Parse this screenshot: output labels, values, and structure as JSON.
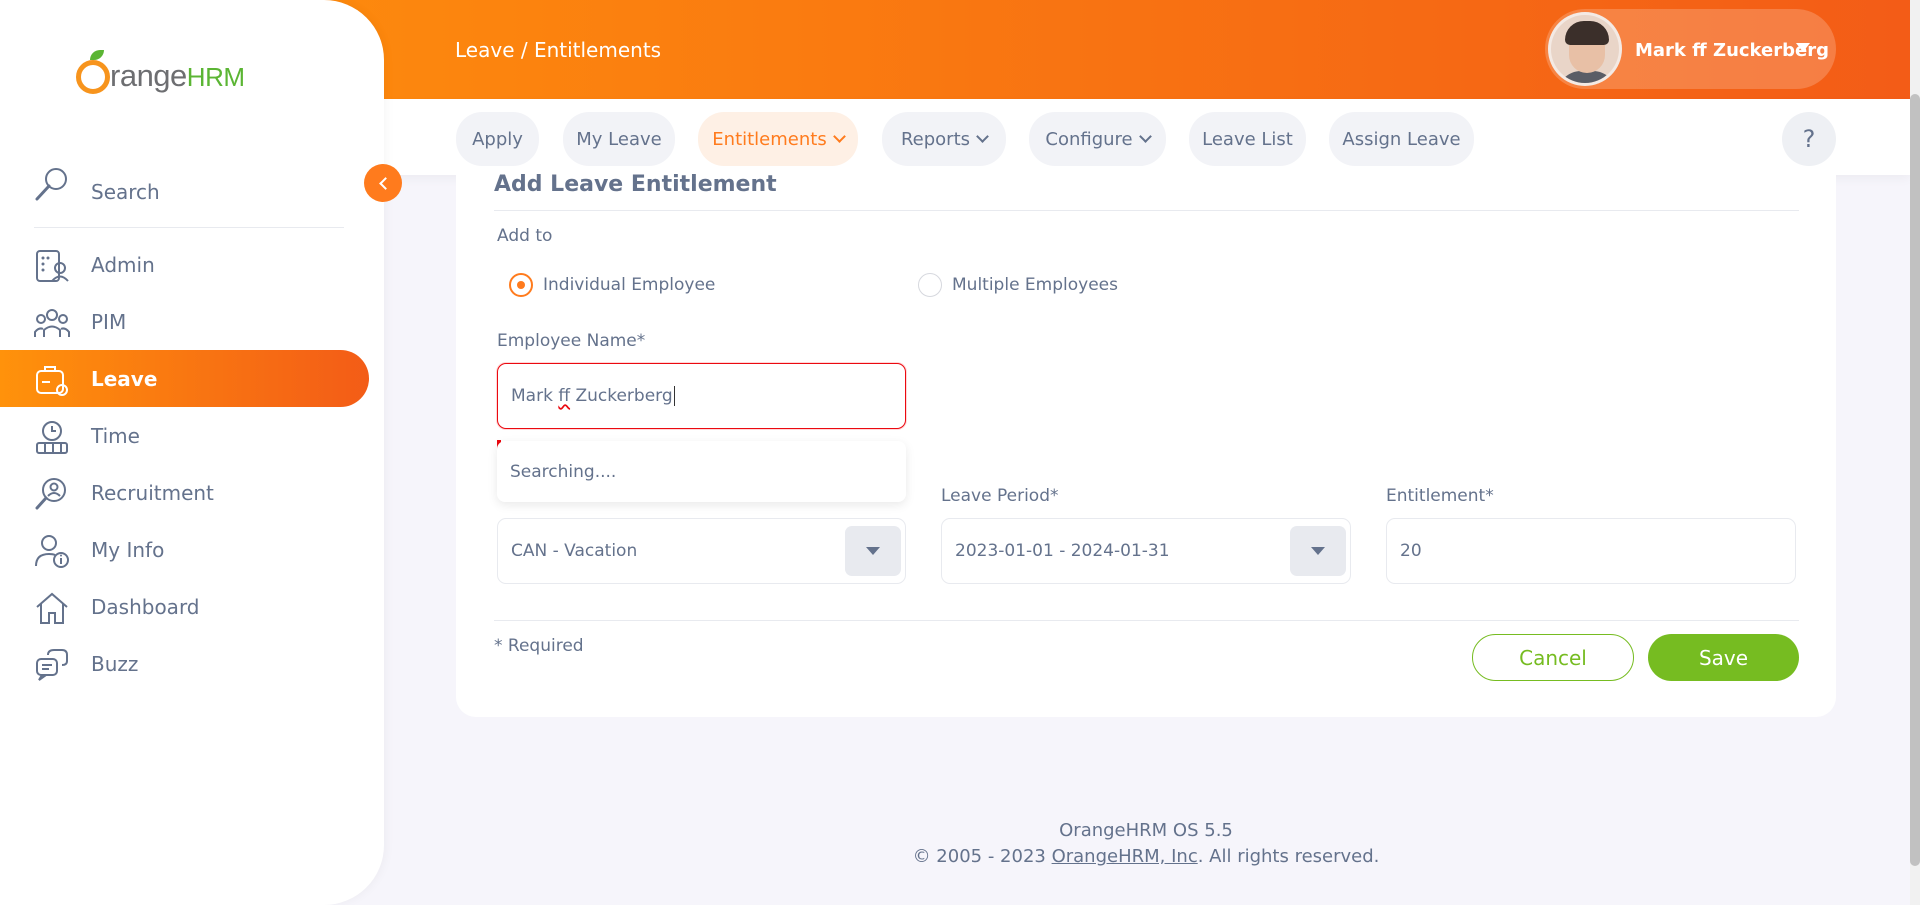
{
  "header": {
    "breadcrumb": "Leave / Entitlements",
    "user_name": "Mark ff Zuckerberg"
  },
  "subnav": {
    "tabs": [
      {
        "label": "Apply"
      },
      {
        "label": "My Leave"
      },
      {
        "label": "Entitlements"
      },
      {
        "label": "Reports"
      },
      {
        "label": "Configure"
      },
      {
        "label": "Leave List"
      },
      {
        "label": "Assign Leave"
      }
    ],
    "help": "?"
  },
  "sidebar": {
    "logo_text": "range",
    "logo_hrm": "HRM",
    "search_label": "Search",
    "items": [
      {
        "label": "Admin",
        "icon": "admin-icon"
      },
      {
        "label": "PIM",
        "icon": "pim-icon"
      },
      {
        "label": "Leave",
        "icon": "leave-icon"
      },
      {
        "label": "Time",
        "icon": "time-icon"
      },
      {
        "label": "Recruitment",
        "icon": "recruitment-icon"
      },
      {
        "label": "My Info",
        "icon": "my-info-icon"
      },
      {
        "label": "Dashboard",
        "icon": "dashboard-icon"
      },
      {
        "label": "Buzz",
        "icon": "buzz-icon"
      }
    ]
  },
  "form": {
    "title": "Add Leave Entitlement",
    "add_to_label": "Add to",
    "radio_individual": "Individual Employee",
    "radio_multiple": "Multiple Employees",
    "employee_name_label": "Employee Name*",
    "employee_name_value_a": "Mark ",
    "employee_name_value_b": "ff",
    "employee_name_value_c": " Zuckerberg",
    "autocomplete_text": "Searching....",
    "leave_type_value": "CAN - Vacation",
    "leave_period_label": "Leave Period*",
    "leave_period_value": "2023-01-01 - 2024-01-31",
    "entitlement_label": "Entitlement*",
    "entitlement_value": "20",
    "required_note": "* Required",
    "cancel_label": "Cancel",
    "save_label": "Save"
  },
  "footer": {
    "version": "OrangeHRM OS 5.5",
    "copyright_prefix": "© 2005 - 2023 ",
    "company_link": "OrangeHRM, Inc",
    "copyright_suffix": ". All rights reserved."
  },
  "colors": {
    "brand_orange": "#ff7b1d",
    "brand_green": "#76bc21",
    "error_red": "#eb0910",
    "text": "#64728c"
  }
}
